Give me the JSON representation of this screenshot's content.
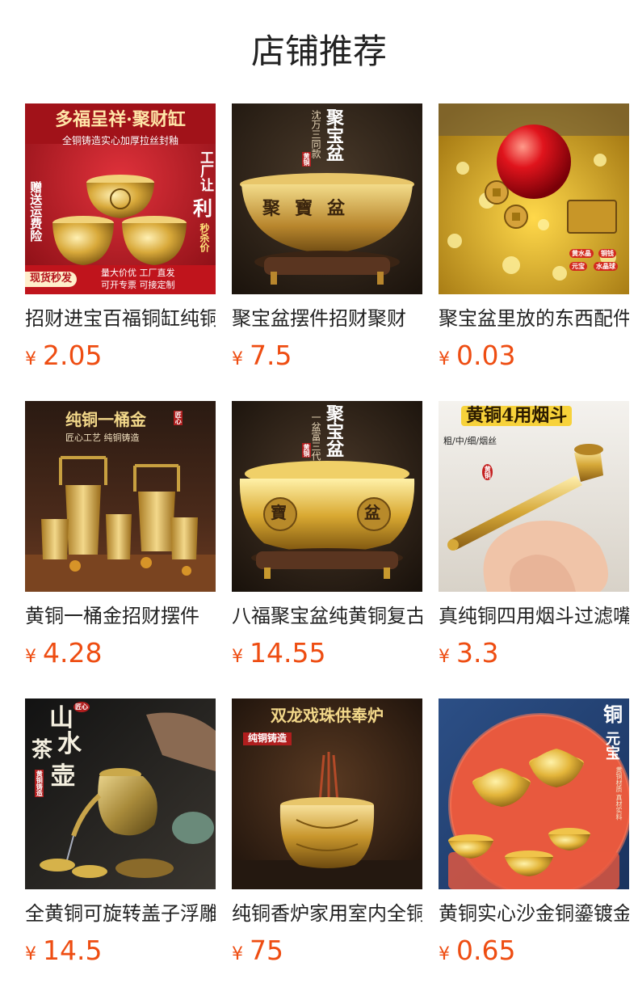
{
  "page": {
    "title": "店铺推荐"
  },
  "currency": "¥",
  "products": [
    {
      "name": "招财进宝百福铜缸纯铜",
      "price": "2.05",
      "overlay": {
        "headline": "多福呈祥·聚财缸",
        "sub": "全铜铸造实心加厚拉丝封釉",
        "side_left": "赠送运费险",
        "side_right_a": "工厂让",
        "side_right_b": "利",
        "side_right_c": "秒杀价",
        "badge": "现货秒发",
        "footer_a": "量大价优 工厂直发",
        "footer_b": "可开专票 可接定制"
      }
    },
    {
      "name": "聚宝盆摆件招财聚财",
      "price": "7.5",
      "overlay": {
        "title_v": "聚宝盆",
        "sub_v": "沈万三同款",
        "seal": "黄铜",
        "bowl_text": "聚寶盆"
      }
    },
    {
      "name": "聚宝盆里放的东西配件",
      "price": "0.03",
      "overlay": {
        "tag_a": "黄水晶",
        "tag_b": "铜钱",
        "tag_c": "元宝",
        "tag_d": "水晶球"
      }
    },
    {
      "name": "黄铜一桶金招财摆件",
      "price": "4.28",
      "overlay": {
        "headline": "纯铜一桶金",
        "sub": "匠心工艺 纯铜铸造",
        "seal": "匠心"
      }
    },
    {
      "name": "八福聚宝盆纯黄铜复古",
      "price": "14.55",
      "overlay": {
        "title_v": "聚宝盆",
        "sub_v": "一盆富三代",
        "seal": "黄铜",
        "bowl_a": "寶",
        "bowl_b": "盆"
      }
    },
    {
      "name": "真纯铜四用烟斗过滤嘴",
      "price": "3.3",
      "overlay": {
        "headline": "黄铜4用烟斗",
        "sub": "粗/中/细/烟丝",
        "seal": "黄铜"
      }
    },
    {
      "name": "全黄铜可旋转盖子浮雕",
      "price": "14.5",
      "overlay": {
        "title_a": "山",
        "title_b": "水",
        "title_c": "茶",
        "title_d": "壶",
        "seal_top": "匠心",
        "seal": "黄铜铸造"
      }
    },
    {
      "name": "纯铜香炉家用室内全铜",
      "price": "75",
      "overlay": {
        "headline": "双龙戏珠供奉炉",
        "sub": "纯铜铸造"
      }
    },
    {
      "name": "黄铜实心沙金铜鎏镀金",
      "price": "0.65",
      "overlay": {
        "title_a": "铜",
        "title_b": "元宝",
        "seal": "铜",
        "note": "黄铜材质 真材实料"
      }
    }
  ]
}
